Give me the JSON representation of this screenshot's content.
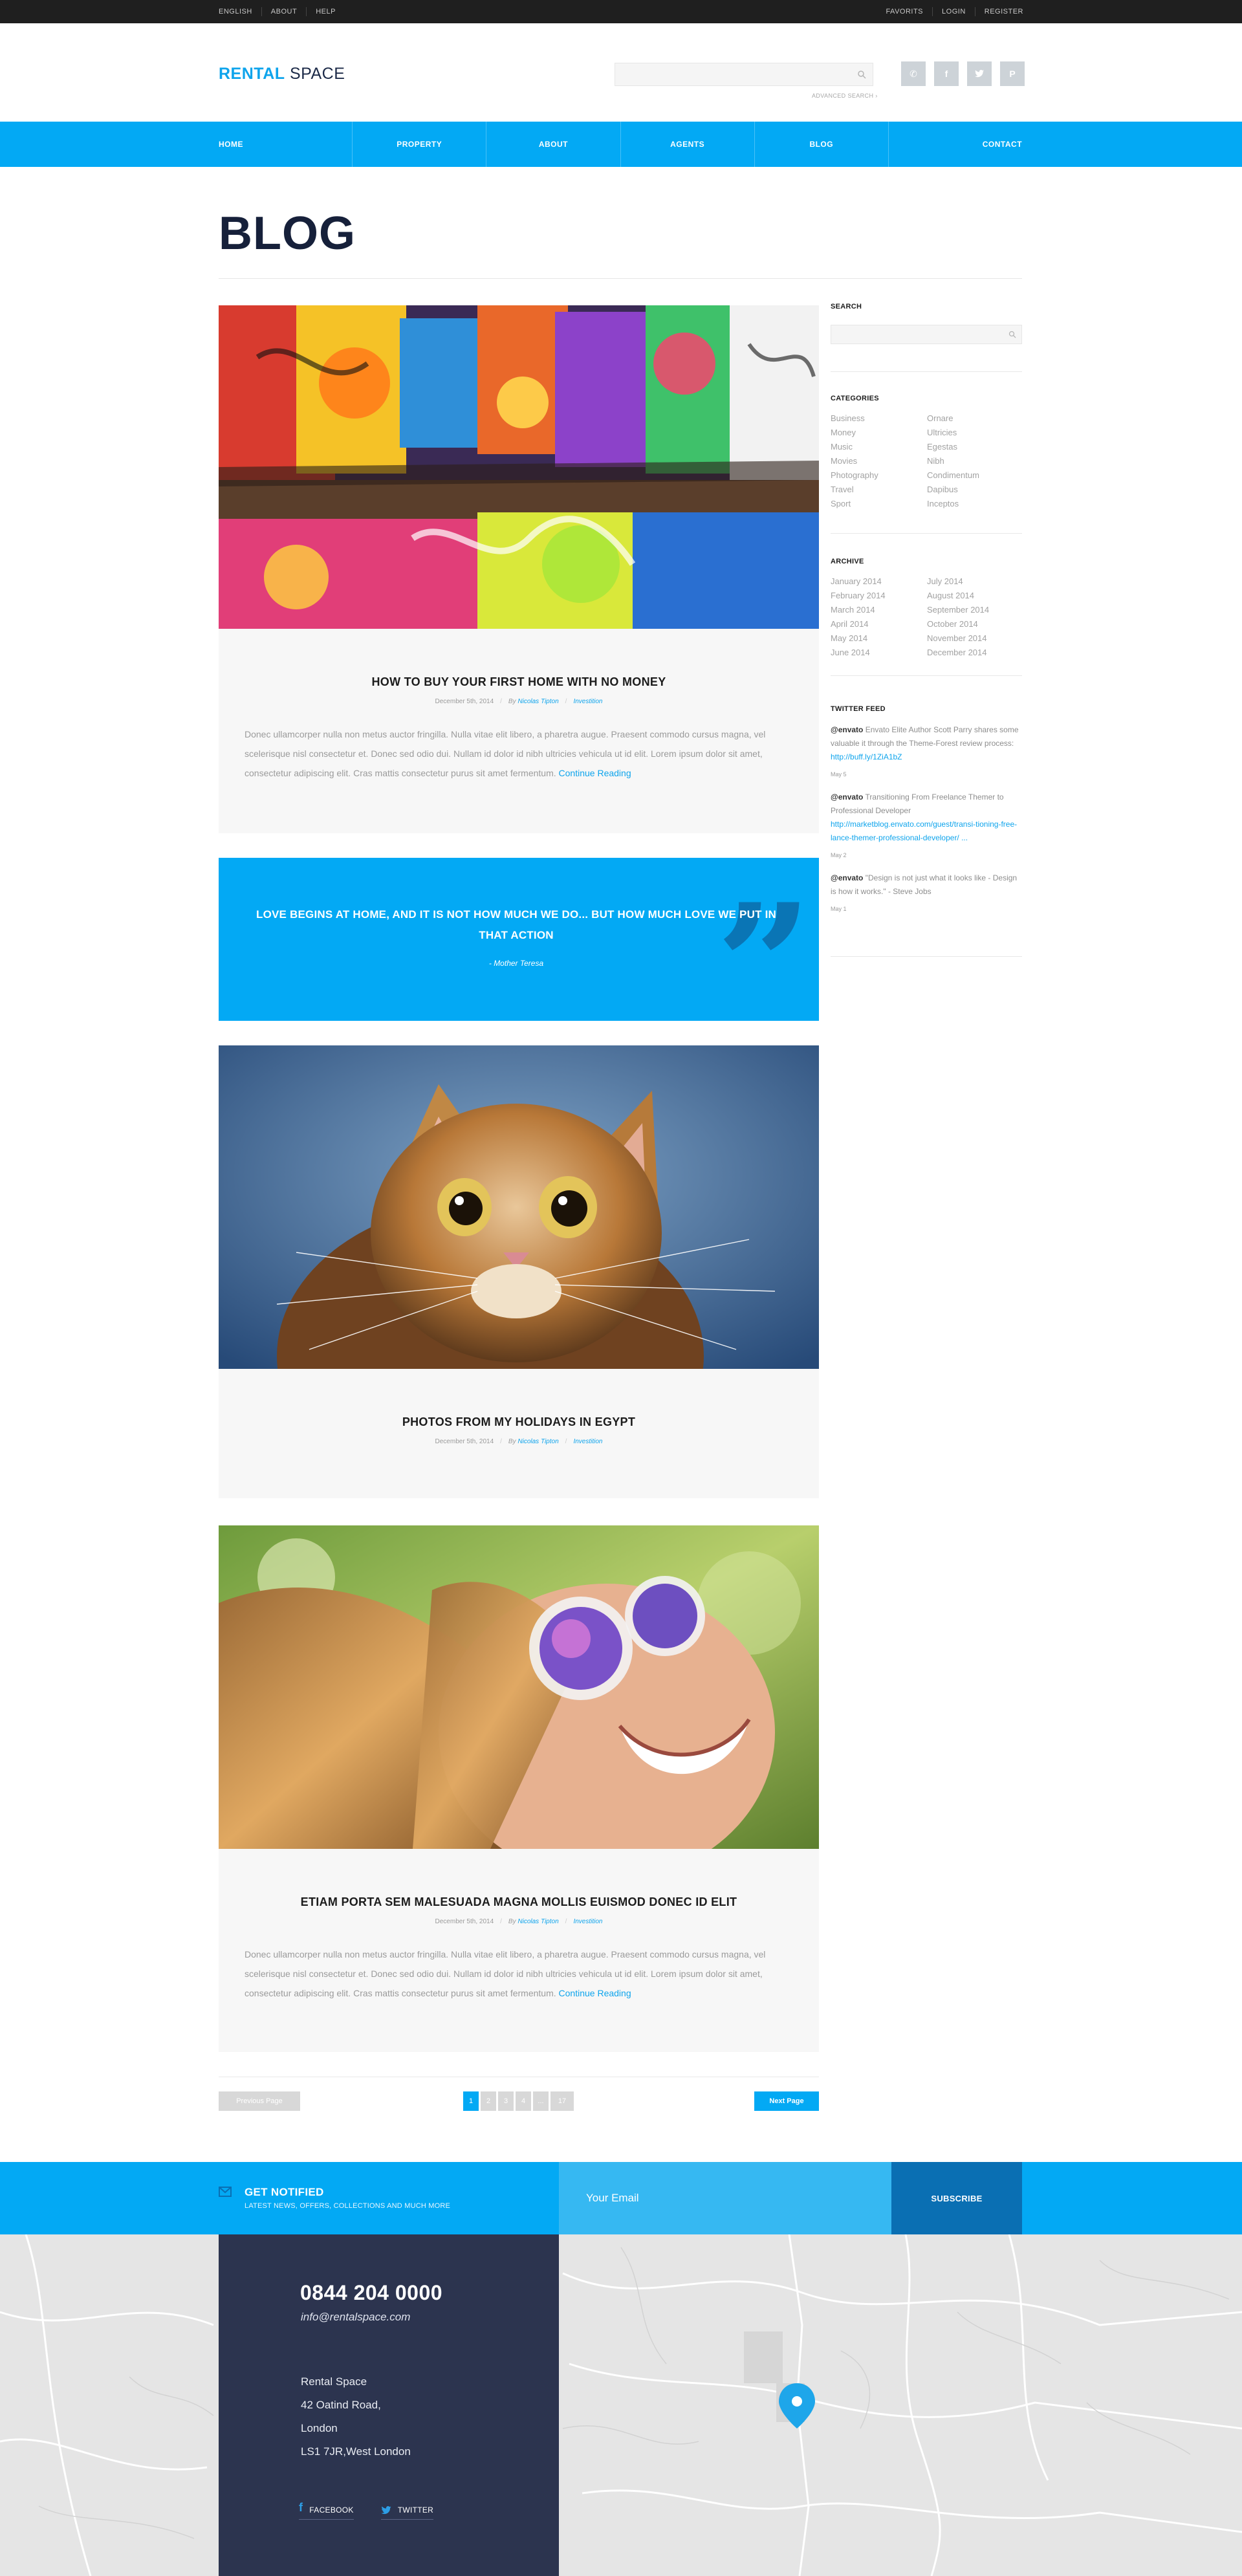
{
  "topbar": {
    "left_links": [
      "ENGLISH",
      "ABOUT",
      "HELP"
    ],
    "right_links": [
      "FAVORITS",
      "LOGIN",
      "REGISTER"
    ]
  },
  "header": {
    "logo_bold": "RENTAL",
    "logo_light": "SPACE",
    "advanced_search": "ADVANCED SEARCH ›",
    "social_icons": [
      "phone-icon",
      "facebook-icon",
      "twitter-icon",
      "pinterest-icon"
    ]
  },
  "nav": {
    "items": [
      "HOME",
      "PROPERTY",
      "ABOUT",
      "AGENTS",
      "BLOG",
      "CONTACT"
    ]
  },
  "page": {
    "title": "BLOG"
  },
  "posts": [
    {
      "title": "HOW TO BUY YOUR FIRST HOME WITH NO MONEY",
      "date": "December 5th, 2014",
      "by": "By",
      "author": "Nicolas Tipton",
      "category": "Investition",
      "excerpt": "Donec ullamcorper nulla non metus auctor fringilla. Nulla vitae elit libero, a pharetra augue. Praesent commodo cursus magna, vel scelerisque nisl consectetur et. Donec sed odio dui. Nullam id dolor id nibh ultricies vehicula ut id elit. Lorem ipsum dolor sit amet, consectetur adipiscing elit. Cras mattis consectetur purus sit amet fermentum.",
      "read_more": "Continue Reading"
    },
    {
      "title": "PHOTOS FROM MY HOLIDAYS IN EGYPT",
      "date": "December 5th, 2014",
      "by": "By",
      "author": "Nicolas Tipton",
      "category": "Investition"
    },
    {
      "title": "ETIAM PORTA SEM MALESUADA MAGNA MOLLIS EUISMOD DONEC ID ELIT",
      "date": "December 5th, 2014",
      "by": "By",
      "author": "Nicolas Tipton",
      "category": "Investition",
      "excerpt": "Donec ullamcorper nulla non metus auctor fringilla. Nulla vitae elit libero, a pharetra augue. Praesent commodo cursus magna, vel scelerisque nisl consectetur et. Donec sed odio dui. Nullam id dolor id nibh ultricies vehicula ut id elit. Lorem ipsum dolor sit amet, consectetur adipiscing elit. Cras mattis consectetur purus sit amet fermentum.",
      "read_more": "Continue Reading"
    }
  ],
  "quote": {
    "text": "LOVE BEGINS AT HOME, AND IT IS NOT HOW MUCH WE DO... BUT HOW MUCH LOVE WE PUT IN THAT ACTION",
    "author": "- Mother Teresa"
  },
  "pagination": {
    "prev": "Previous Page",
    "next": "Next Page",
    "pages": [
      "1",
      "2",
      "3",
      "4",
      "...",
      "17"
    ],
    "current": "1"
  },
  "sidebar": {
    "search_heading": "SEARCH",
    "categories_heading": "CATEGORIES",
    "categories_left": [
      "Business",
      "Money",
      "Music",
      "Movies",
      "Photography",
      "Travel",
      "Sport"
    ],
    "categories_right": [
      "Ornare",
      "Ultricies",
      "Egestas",
      "Nibh",
      "Condimentum",
      "Dapibus",
      "Inceptos"
    ],
    "archive_heading": "ARCHIVE",
    "archive_left": [
      "January 2014",
      "February 2014",
      "March 2014",
      "April 2014",
      "May 2014",
      "June 2014"
    ],
    "archive_right": [
      "July 2014",
      "August 2014",
      "September 2014",
      "October 2014",
      "November 2014",
      "December 2014"
    ],
    "twitter_heading": "TWITTER FEED",
    "tweets": [
      {
        "handle": "@envato",
        "text": "Envato Elite Author Scott Parry shares some valuable it through the Theme-Forest review process:",
        "link": "http://buff.ly/1ZiA1bZ",
        "date": "May 5"
      },
      {
        "handle": "@envato",
        "text": "Transitioning From Freelance Themer to Professional Developer",
        "link": "http://marketblog.envato.com/guest/transi-tioning-free-lance-themer-professional-developer/ ...",
        "date": "May 2"
      },
      {
        "handle": "@envato",
        "text": "\"Design is not just what it looks like - Design is how it works.\" - Steve Jobs",
        "date": "May 1"
      }
    ]
  },
  "newsletter": {
    "title": "GET NOTIFIED",
    "subtitle": "LATEST NEWS, OFFERS, COLLECTIONS AND MUCH MORE",
    "placeholder": "Your Email",
    "button": "SUBSCRIBE"
  },
  "contact": {
    "phone": "0844 204 0000",
    "email": "info@rentalspace.com",
    "address": [
      "Rental Space",
      "42 Oatind Road,",
      "London",
      "LS1 7JR,West London"
    ],
    "social": [
      {
        "icon": "facebook-icon",
        "label": "FACEBOOK"
      },
      {
        "icon": "twitter-icon",
        "label": "TWITTER"
      }
    ]
  },
  "colors": {
    "brand_blue": "#03a9f4",
    "dark_navy": "#2c344f",
    "subscribe_blue": "#0a6fb3",
    "title_navy": "#16203a"
  }
}
